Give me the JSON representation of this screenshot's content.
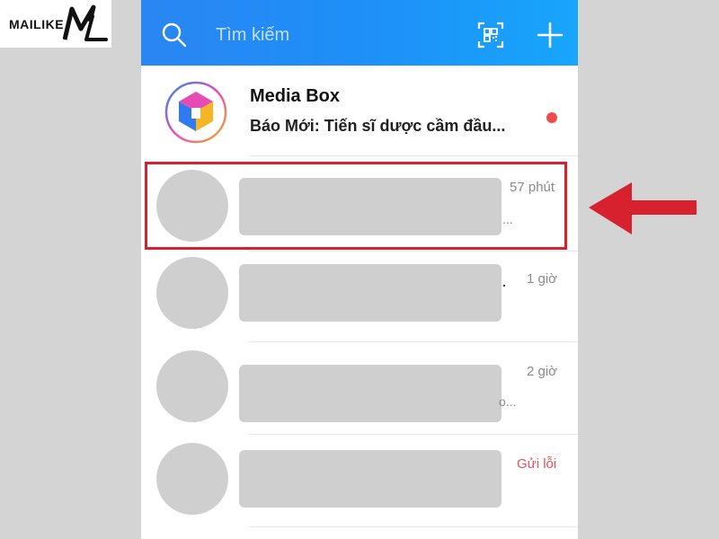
{
  "watermark": {
    "logo_text": "MAILIKE"
  },
  "header": {
    "search_placeholder": "Tìm kiếm",
    "icons": [
      "search-icon",
      "qr-scan-icon",
      "plus-icon"
    ],
    "gradient_colors": [
      "#2a86f2",
      "#17a6fb"
    ]
  },
  "pinned": {
    "title": "Media Box",
    "preview": "Báo Mới: Tiến sĩ dược cầm đầu...",
    "unread_color": "#ef4b4b"
  },
  "conversations": [
    {
      "time": "57 phút",
      "trailing": "..."
    },
    {
      "time": "1 giờ",
      "trailing": "."
    },
    {
      "time": "2 giờ",
      "trailing": "o..."
    },
    {
      "time": "Gửi lỗi",
      "status": "error"
    }
  ],
  "colors": {
    "highlight_border": "#d8212f",
    "arrow": "#d8212f",
    "error_text": "#e2515b"
  }
}
